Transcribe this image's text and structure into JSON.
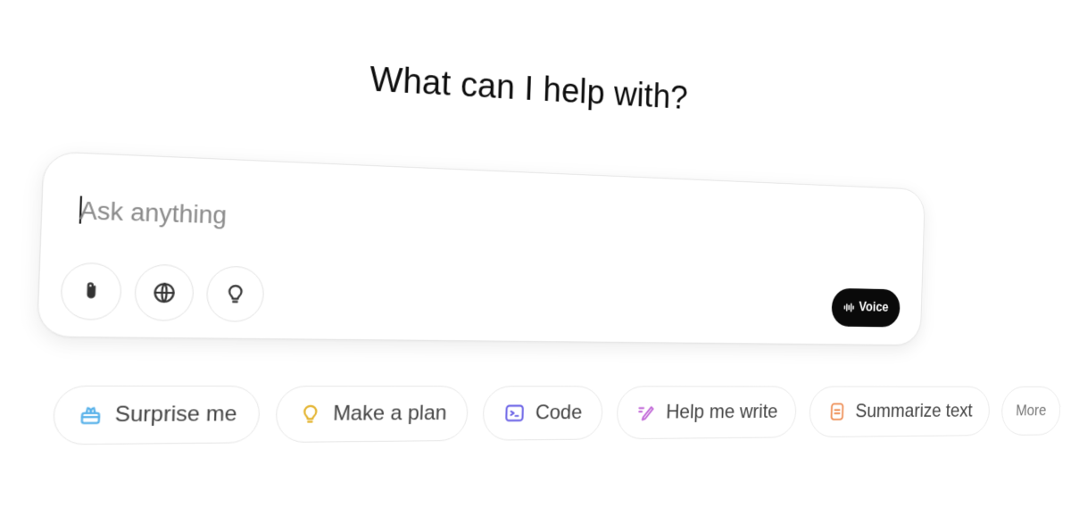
{
  "heading": "What can I help with?",
  "composer": {
    "placeholder": "Ask anything",
    "tools": [
      {
        "name": "attach",
        "icon": "paperclip-icon"
      },
      {
        "name": "search",
        "icon": "globe-icon"
      },
      {
        "name": "reason",
        "icon": "lightbulb-icon"
      }
    ],
    "voice_label": "Voice",
    "voice_icon": "waveform-icon"
  },
  "suggestions": [
    {
      "label": "Surprise me",
      "icon": "gift-icon",
      "color": "#5bb3ea"
    },
    {
      "label": "Make a plan",
      "icon": "lightbulb-icon",
      "color": "#e3b22b"
    },
    {
      "label": "Code",
      "icon": "terminal-icon",
      "color": "#6b63e6"
    },
    {
      "label": "Help me write",
      "icon": "pen-icon",
      "color": "#c26ad8"
    },
    {
      "label": "Summarize text",
      "icon": "document-icon",
      "color": "#ee8e55"
    },
    {
      "label": "More"
    }
  ],
  "colors": {
    "background": "#ffffff",
    "voice_button": "#0a0a0a",
    "border": "#e5e5e5"
  }
}
